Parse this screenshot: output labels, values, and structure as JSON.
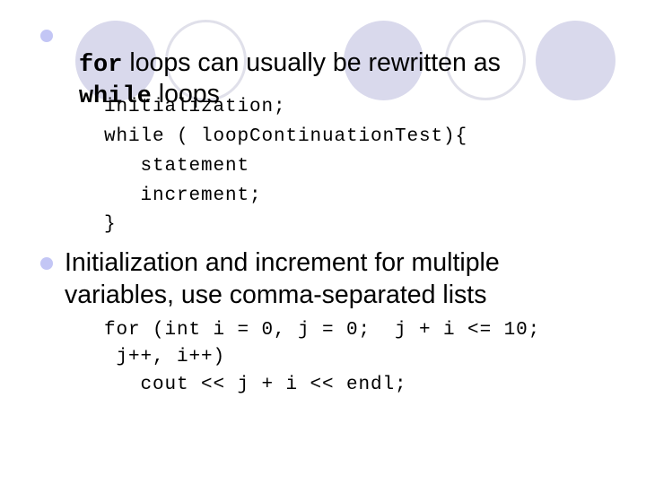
{
  "slide": {
    "bullets": [
      {
        "line1": {
          "code": "for",
          "text": " loops can usually be rewritten as"
        },
        "line2": {
          "code": "while",
          "text": " loops"
        },
        "code_lines": [
          "initialization;",
          "while ( loopContinuationTest){",
          "   statement",
          "   increment;",
          "}"
        ]
      },
      {
        "line1": "Initialization and increment for multiple",
        "line2": "variables, use comma-separated lists",
        "code_lines": [
          "for (int i = 0, j = 0;  j + i <= 10;",
          " j++, i++)",
          "   cout << j + i << endl;"
        ]
      }
    ]
  },
  "theme": {
    "bullet_color": "#c3c6f5",
    "decoration_fill": "#d9d9ec",
    "decoration_stroke": "#e0e0ea"
  }
}
